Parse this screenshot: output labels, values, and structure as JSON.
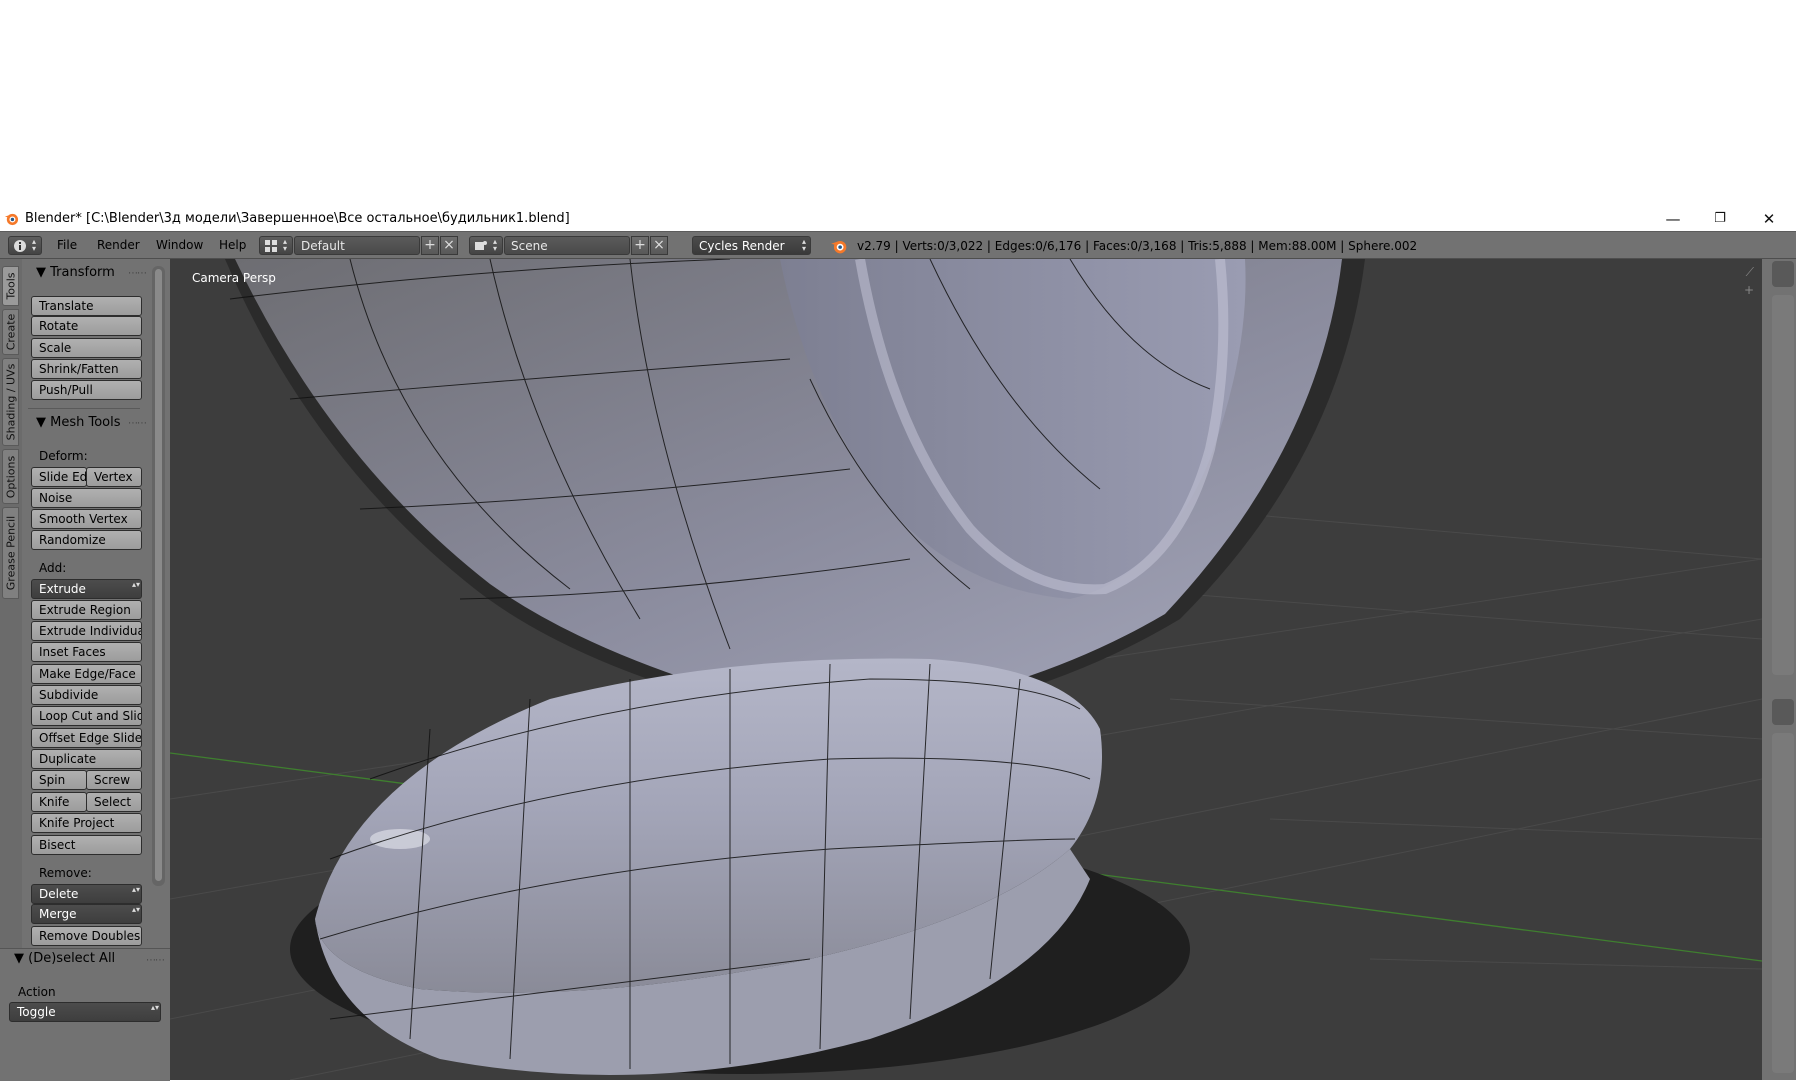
{
  "window": {
    "title": "Blender* [C:\\Blender\\3д модели\\Завершенное\\Все остальное\\будильник1.blend]",
    "minimize": "—",
    "maximize": "❐",
    "close": "✕"
  },
  "header": {
    "menus": [
      "File",
      "Render",
      "Window",
      "Help"
    ],
    "screen_layout": "Default",
    "scene": "Scene",
    "render_engine": "Cycles Render",
    "stats": "v2.79 | Verts:0/3,022 | Edges:0/6,176 | Faces:0/3,168 | Tris:5,888 | Mem:88.00M | Sphere.002"
  },
  "tool_tabs": [
    "Tools",
    "Create",
    "Shading / UVs",
    "Options",
    "Grease Pencil"
  ],
  "tool_panel": {
    "transform": {
      "title": "Transform",
      "buttons": [
        "Translate",
        "Rotate",
        "Scale",
        "Shrink/Fatten",
        "Push/Pull"
      ]
    },
    "mesh_tools": {
      "title": "Mesh Tools",
      "deform_label": "Deform:",
      "slide_edge": "Slide Ed",
      "vertex": "Vertex",
      "noise": "Noise",
      "smooth_vertex": "Smooth Vertex",
      "randomize": "Randomize",
      "add_label": "Add:",
      "extrude_menu": "Extrude",
      "extrude_region": "Extrude Region",
      "extrude_individual": "Extrude Individual",
      "inset_faces": "Inset Faces",
      "make_edge_face": "Make Edge/Face",
      "subdivide": "Subdivide",
      "loop_cut_slide": "Loop Cut and Slide",
      "offset_edge_slide": "Offset Edge Slide",
      "duplicate": "Duplicate",
      "spin": "Spin",
      "screw": "Screw",
      "knife": "Knife",
      "select": "Select",
      "knife_project": "Knife Project",
      "bisect": "Bisect",
      "remove_label": "Remove:",
      "delete_menu": "Delete",
      "merge_menu": "Merge",
      "remove_doubles": "Remove Doubles"
    }
  },
  "operator_panel": {
    "title": "(De)select All",
    "action_label": "Action",
    "action_value": "Toggle"
  },
  "viewport": {
    "view_label": "Camera Persp"
  }
}
